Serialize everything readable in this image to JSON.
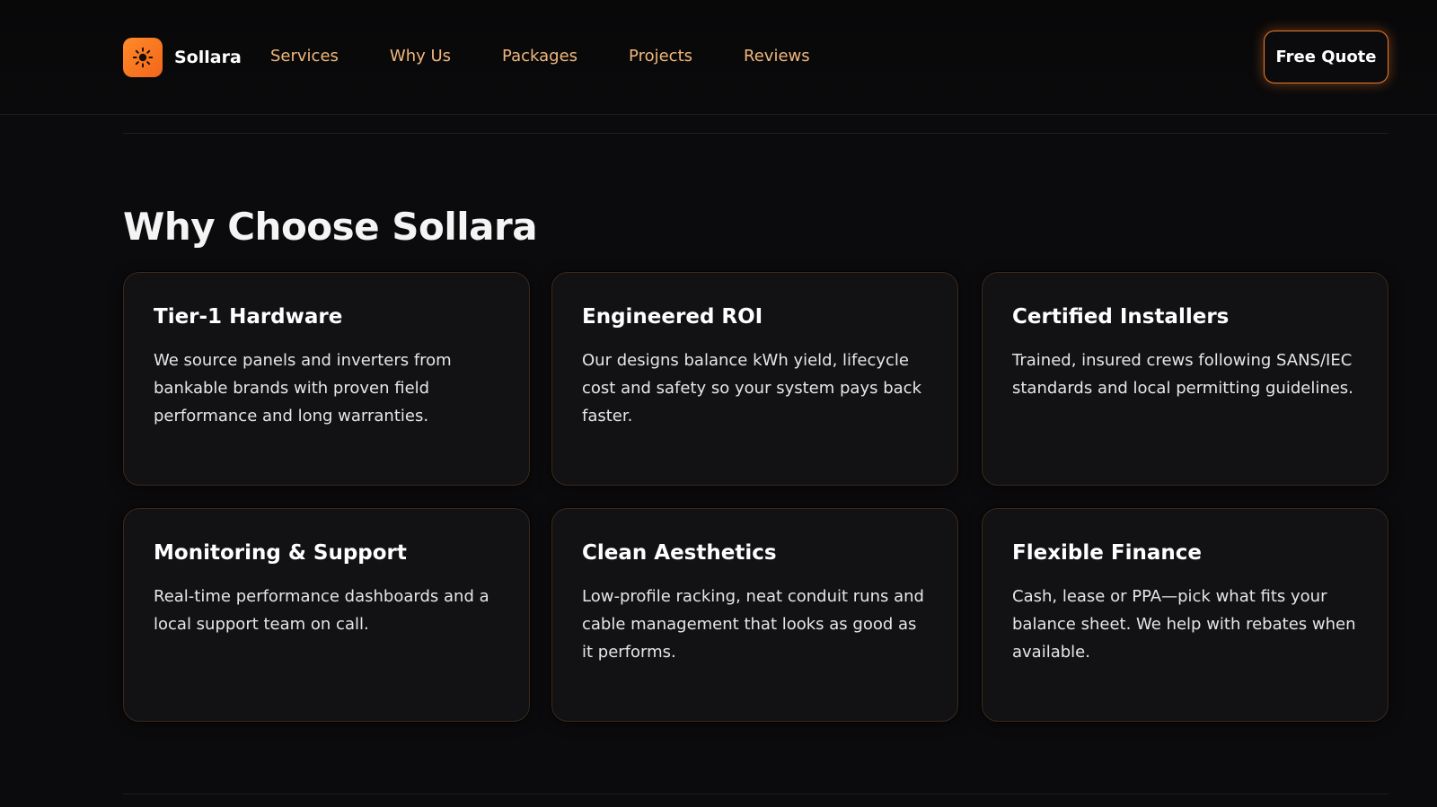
{
  "brand": {
    "name": "Sollara",
    "logo_icon": "sun-icon",
    "accent": "#f2661a"
  },
  "nav": {
    "items": [
      {
        "label": "Services"
      },
      {
        "label": "Why Us"
      },
      {
        "label": "Packages"
      },
      {
        "label": "Projects"
      },
      {
        "label": "Reviews"
      }
    ],
    "cta_label": "Free Quote"
  },
  "section": {
    "title": "Why Choose Sollara",
    "cards": [
      {
        "title": "Tier-1 Hardware",
        "text": "We source panels and inverters from bankable brands with proven field performance and long warranties."
      },
      {
        "title": "Engineered ROI",
        "text": "Our designs balance kWh yield, lifecycle cost and safety so your system pays back faster."
      },
      {
        "title": "Certified Installers",
        "text": "Trained, insured crews following SANS/IEC standards and local permitting guidelines."
      },
      {
        "title": "Monitoring & Support",
        "text": "Real-time performance dashboards and a local support team on call."
      },
      {
        "title": "Clean Aesthetics",
        "text": "Low-profile racking, neat conduit runs and cable management that looks as good as it performs."
      },
      {
        "title": "Flexible Finance",
        "text": "Cash, lease or PPA—pick what fits your balance sheet. We help with rebates when available."
      }
    ]
  },
  "colors": {
    "background": "#0b0b0d",
    "nav_link": "#f0b77a",
    "card_bg": "#121215"
  }
}
